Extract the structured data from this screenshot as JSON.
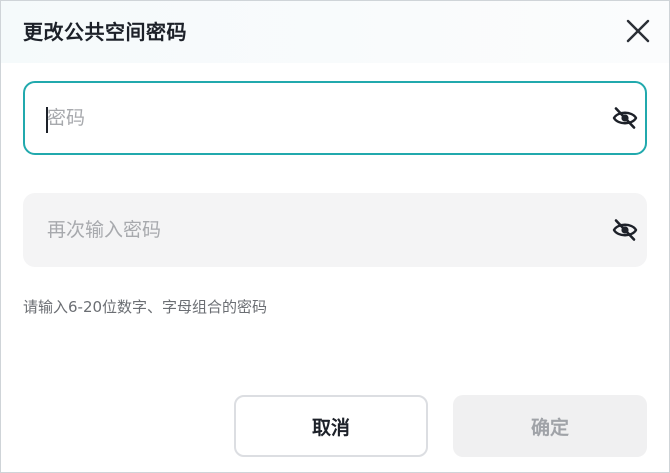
{
  "dialog": {
    "title": "更改公共空间密码",
    "close_icon": "close-icon"
  },
  "password_field": {
    "placeholder": "密码",
    "value": "",
    "toggle_icon": "eye-off-icon",
    "focused": true,
    "border_color": "#21a9ad"
  },
  "confirm_field": {
    "placeholder": "再次输入密码",
    "value": "",
    "toggle_icon": "eye-off-icon"
  },
  "hint": "请输入6-20位数字、字母组合的密码",
  "buttons": {
    "cancel_label": "取消",
    "ok_label": "确定",
    "ok_disabled": true
  }
}
